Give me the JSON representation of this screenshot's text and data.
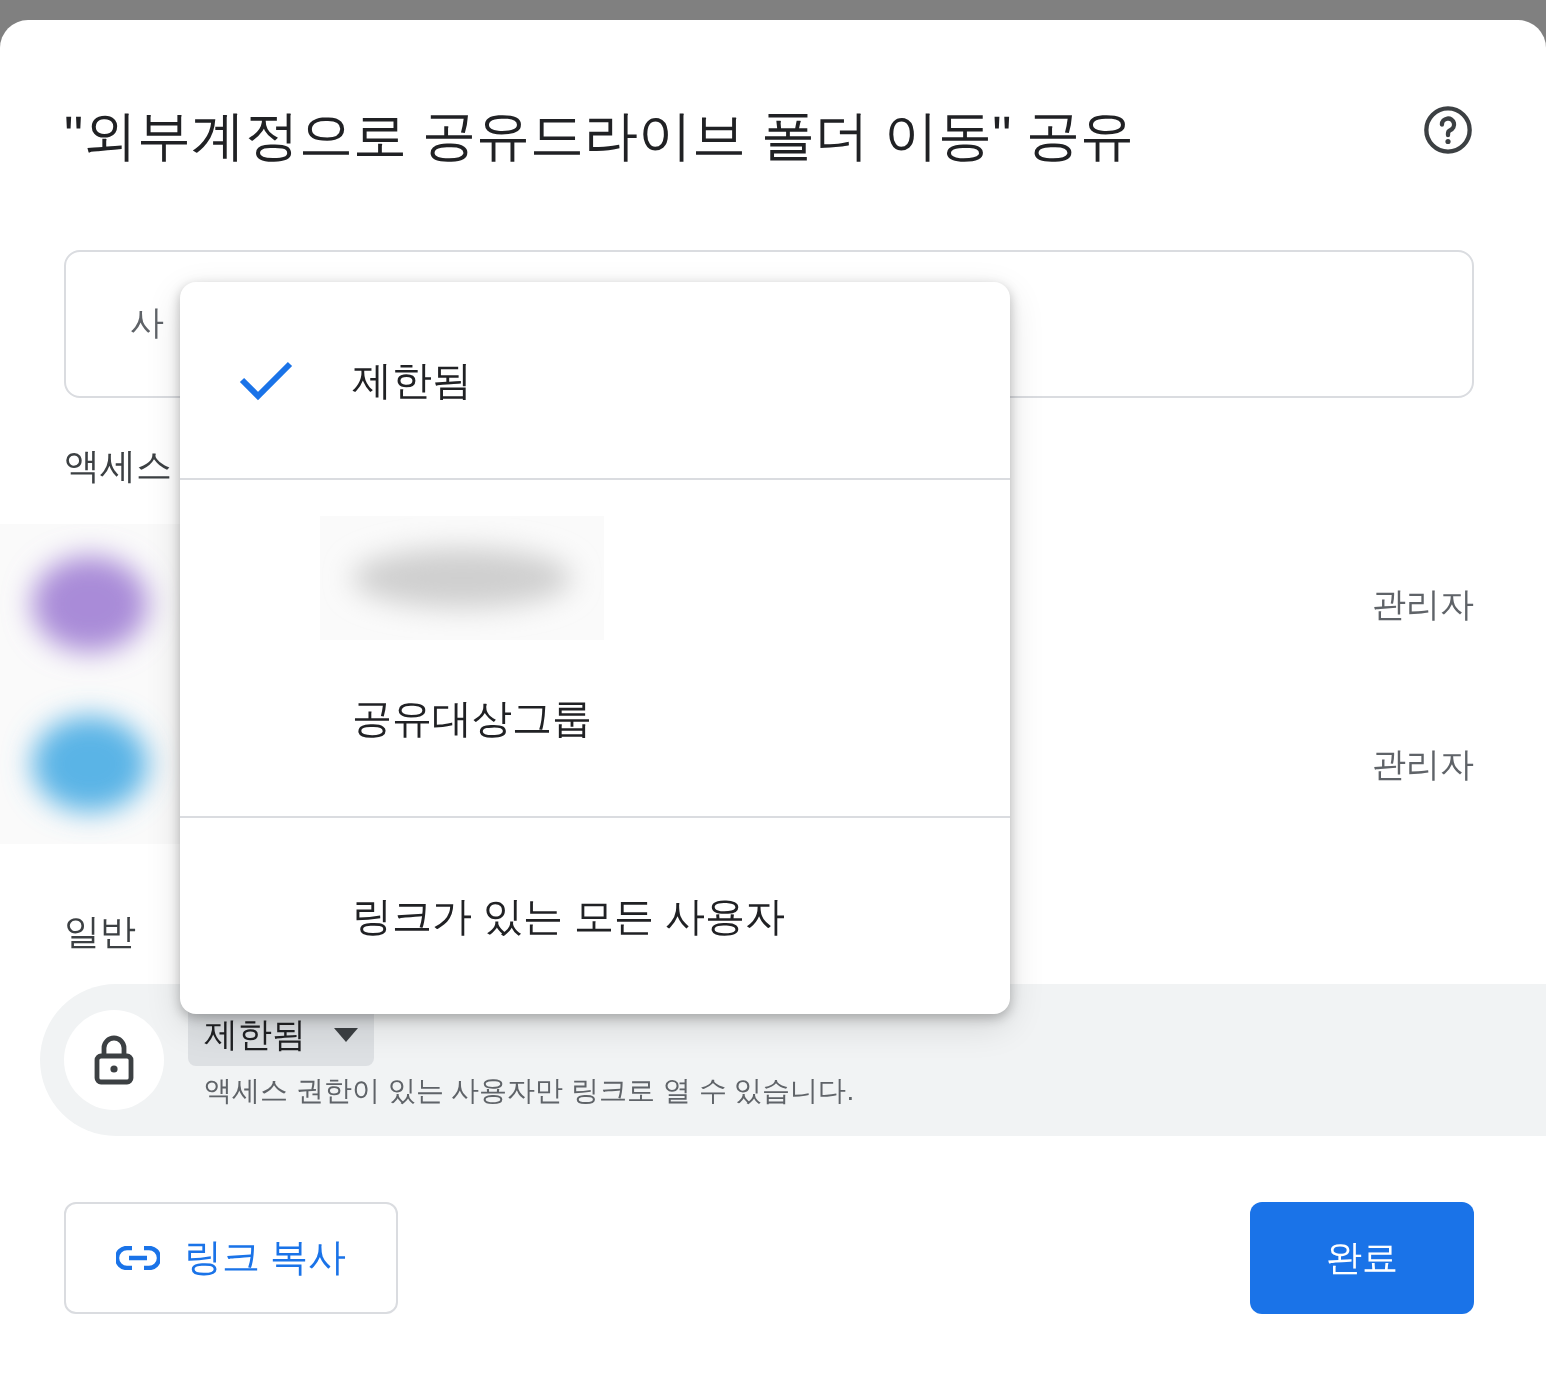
{
  "dialog": {
    "title": "\"외부계정으로 공유드라이브 폴더 이동\" 공유"
  },
  "people_field": {
    "placeholder": "사"
  },
  "access_label": "액세스",
  "people": [
    {
      "color": "#a98bd8",
      "role": "관리자"
    },
    {
      "color": "#5ab4e6",
      "role": "관리자"
    }
  ],
  "general_label": "일반",
  "general_access": {
    "value": "제한됨",
    "description": "액세스 권한이 있는 사용자만 링크로 열 수 있습니다."
  },
  "menu": {
    "sections": [
      [
        {
          "kind": "option",
          "label": "제한됨",
          "selected": true
        }
      ],
      [
        {
          "kind": "picture"
        },
        {
          "kind": "option",
          "label": "공유대상그룹",
          "selected": false
        }
      ],
      [
        {
          "kind": "option",
          "label": "링크가 있는 모든 사용자",
          "selected": false
        }
      ]
    ]
  },
  "buttons": {
    "copy_link": "링크 복사",
    "done": "완료"
  }
}
